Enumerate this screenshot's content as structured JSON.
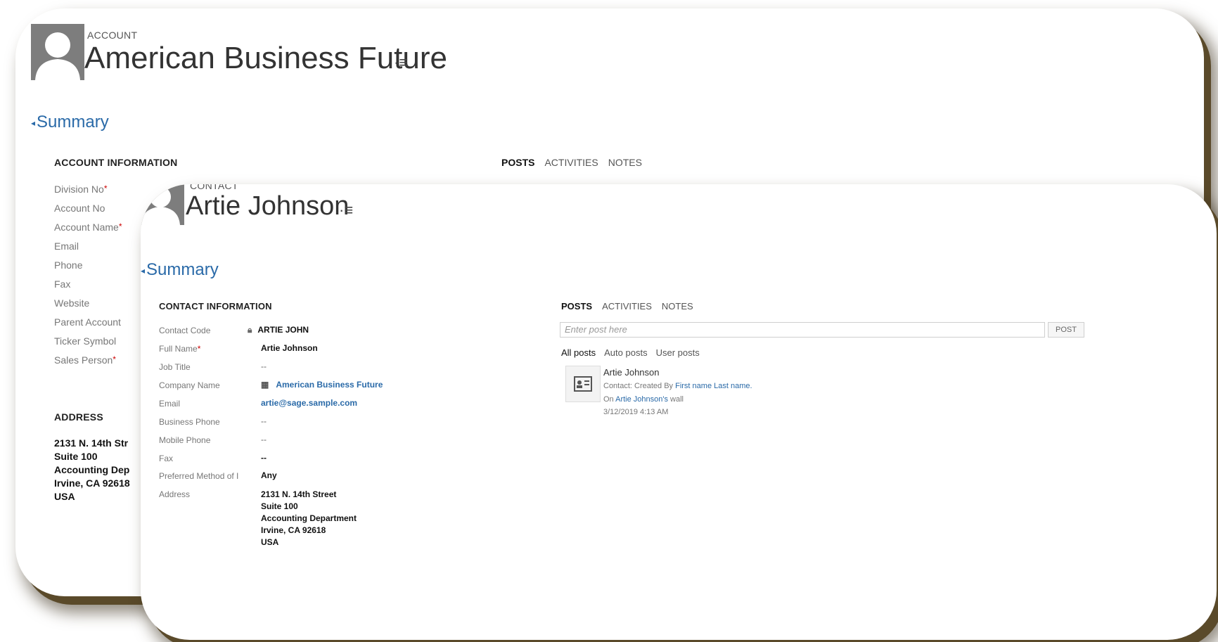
{
  "account": {
    "entity_type": "ACCOUNT",
    "name": "American Business Future",
    "menu_icon": "nav-menu-icon",
    "summary_label": "Summary",
    "section_title": "ACCOUNT INFORMATION",
    "tabs": [
      "POSTS",
      "ACTIVITIES",
      "NOTES"
    ],
    "fields": [
      {
        "label": "Division No",
        "required": "*"
      },
      {
        "label": "Account No",
        "required": ""
      },
      {
        "label": "Account Name",
        "required": "*"
      },
      {
        "label": "Email",
        "required": ""
      },
      {
        "label": "Phone",
        "required": ""
      },
      {
        "label": "Fax",
        "required": ""
      },
      {
        "label": "Website",
        "required": ""
      },
      {
        "label": "Parent Account",
        "required": ""
      },
      {
        "label": "Ticker Symbol",
        "required": ""
      },
      {
        "label": "Sales Person",
        "required": "*"
      }
    ],
    "address_title": "ADDRESS",
    "address_lines": [
      "2131 N. 14th Str",
      "Suite 100",
      "Accounting Dep",
      "Irvine, CA 92618",
      "USA"
    ]
  },
  "contact": {
    "entity_type": "CONTACT",
    "name": "Artie Johnson",
    "summary_label": "Summary",
    "section_title": "CONTACT INFORMATION",
    "tabs": [
      "POSTS",
      "ACTIVITIES",
      "NOTES"
    ],
    "fields": [
      {
        "label": "Contact Code",
        "required": "",
        "value": "ARTIE JOHN",
        "icon": "lock-icon"
      },
      {
        "label": "Full Name",
        "required": "*",
        "value": "Artie Johnson"
      },
      {
        "label": "Job Title",
        "required": "",
        "value": "--"
      },
      {
        "label": "Company Name",
        "required": "",
        "value": "American Business Future",
        "icon": "building-icon"
      },
      {
        "label": "Email",
        "required": "",
        "value": "artie@sage.sample.com"
      },
      {
        "label": "Business Phone",
        "required": "",
        "value": "--"
      },
      {
        "label": "Mobile Phone",
        "required": "",
        "value": "--"
      },
      {
        "label": "Fax",
        "required": "",
        "value": "--"
      },
      {
        "label": "Preferred Method of I",
        "required": "",
        "value": "Any"
      },
      {
        "label": "Address",
        "required": "",
        "value": ""
      }
    ],
    "address_lines": [
      "2131 N. 14th Street",
      "Suite 100",
      "Accounting Department",
      "Irvine, CA 92618",
      "USA"
    ],
    "post_placeholder": "Enter post here",
    "post_button": "POST",
    "post_filters": [
      "All posts",
      "Auto posts",
      "User posts"
    ],
    "post": {
      "author": "Artie Johnson",
      "line1_prefix": "Contact: Created By ",
      "line1_link": "First name Last name.",
      "line2_prefix": "On ",
      "line2_link": "Artie Johnson's",
      "line2_suffix": " wall",
      "timestamp": "3/12/2019 4:13 AM"
    }
  },
  "colors": {
    "accent": "#2a6aa8",
    "required": "#cc0000",
    "card_shadow": "#5a4a2a"
  }
}
